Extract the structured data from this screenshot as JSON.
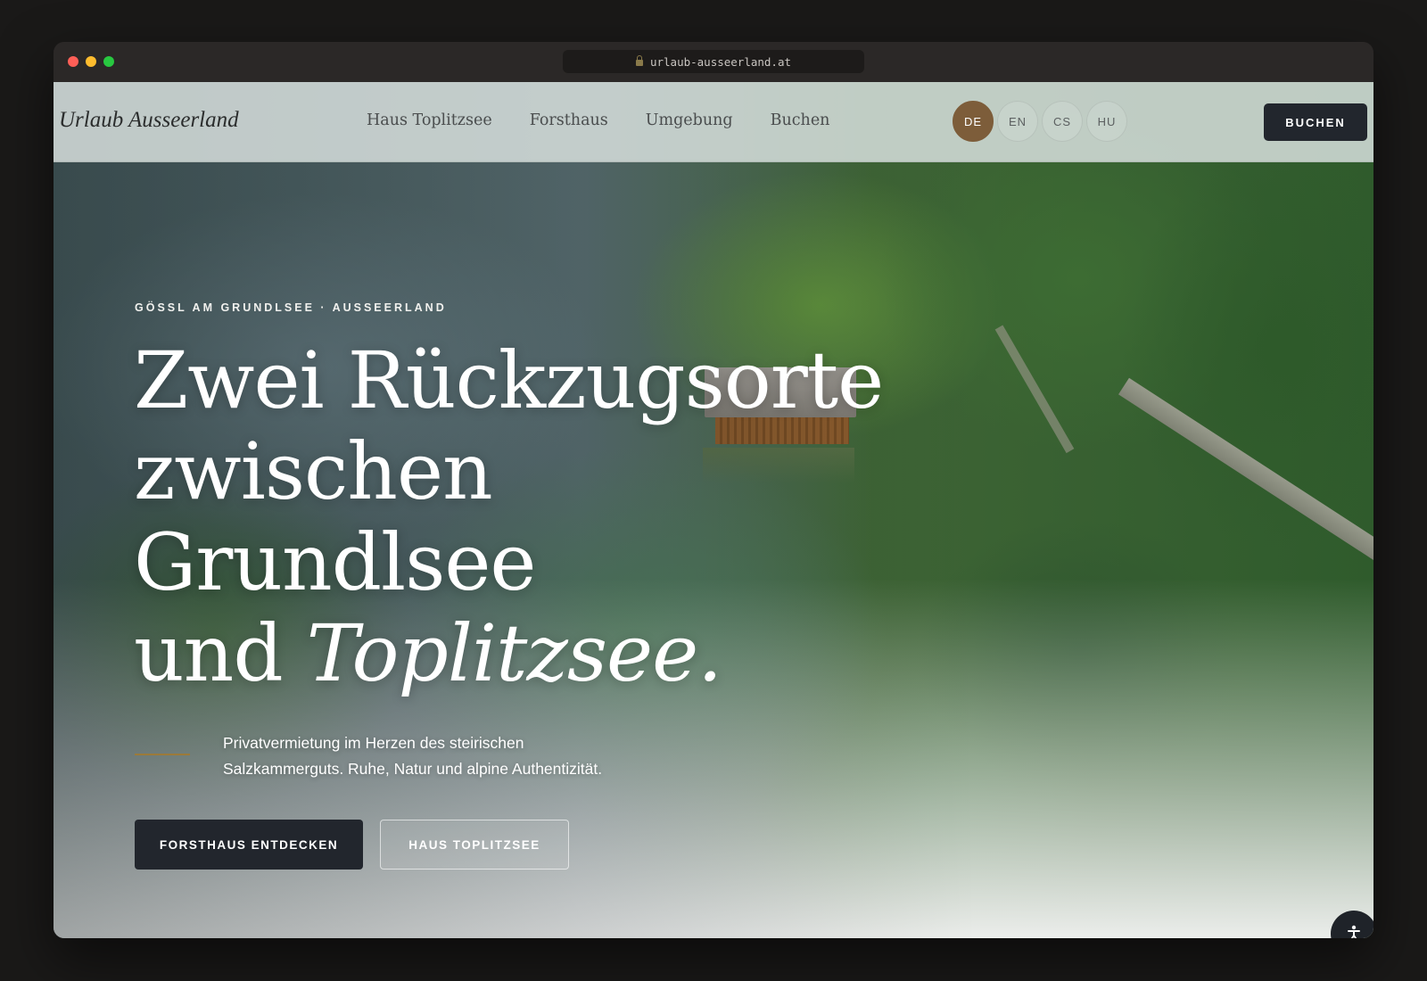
{
  "browser": {
    "url": "urlaub-ausseerland.at"
  },
  "nav": {
    "brand": "Urlaub Ausseerland",
    "items": [
      {
        "label": "Haus Toplitzsee"
      },
      {
        "label": "Forsthaus"
      },
      {
        "label": "Umgebung"
      },
      {
        "label": "Buchen"
      }
    ],
    "languages": [
      {
        "code": "DE",
        "active": true
      },
      {
        "code": "EN",
        "active": false
      },
      {
        "code": "CS",
        "active": false
      },
      {
        "code": "HU",
        "active": false
      }
    ],
    "book_label": "BUCHEN"
  },
  "hero": {
    "eyebrow": "GÖSSL AM GRUNDLSEE · AUSSEERLAND",
    "headline": {
      "line1": "Zwei Rückzugsorte",
      "line2": "zwischen",
      "line3": "Grundlsee",
      "line4_plain": "und ",
      "line4_italic": "Toplitzsee."
    },
    "subtitle": "Privatvermietung im Herzen des steirischen Salzkammerguts. Ruhe, Natur und alpine Authentizität.",
    "cta_primary": "FORSTHAUS ENTDECKEN",
    "cta_secondary": "HAUS TOPLITZSEE"
  },
  "icons": {
    "lock": "lock-icon",
    "accessibility": "accessibility-icon"
  },
  "colors": {
    "accent_brown": "#7d5d3a",
    "dark_button": "#22262d",
    "rule_gold": "#9b7a3a"
  }
}
